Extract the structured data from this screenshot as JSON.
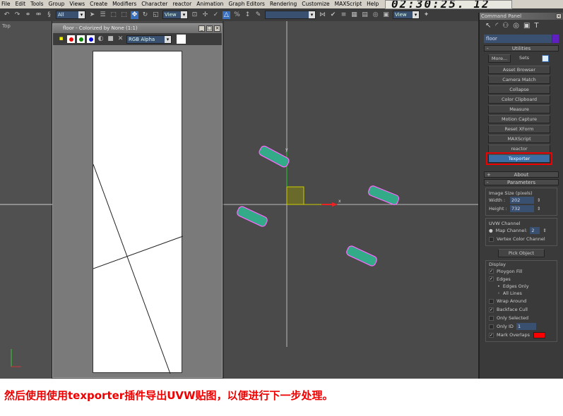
{
  "menu": [
    "File",
    "Edit",
    "Tools",
    "Group",
    "Views",
    "Create",
    "Modifiers",
    "Character",
    "reactor",
    "Animation",
    "Graph Editors",
    "Rendering",
    "Customize",
    "MAXScript",
    "Help"
  ],
  "toolbar": {
    "selection_filter": "All",
    "ref_coord": "View",
    "ref_coord2": "View",
    "named_sel": ""
  },
  "timer": "02:30:25. 12",
  "viewport": {
    "left_label": "Top",
    "axis_x": "x",
    "axis_y": "y"
  },
  "image_window": {
    "title": "floor - Colorized by None (1:1)",
    "channel": "RGB Alpha"
  },
  "command_panel": {
    "title": "Command Panel",
    "object_name": "floor",
    "object_color": "#6020c0",
    "utilities": {
      "header": "Utilities",
      "more": "More...",
      "sets": "Sets",
      "buttons": [
        "Asset Browser",
        "Camera Match",
        "Collapse",
        "Color Clipboard",
        "Measure",
        "Motion Capture",
        "Reset XForm",
        "MAXScript",
        "reactor",
        "Texporter"
      ],
      "active": "Texporter"
    },
    "about": "About",
    "parameters": "Parameters",
    "image_size": {
      "label": "Image Size (pixels)",
      "width_label": "Width :",
      "width": "202",
      "height_label": "Height :",
      "height": "732"
    },
    "uvw": {
      "label": "UVW Channel",
      "map_channel_label": "Map Channel:",
      "map_channel": "2",
      "vertex_color": "Vertex Color Channel"
    },
    "pick_object": "Pick Object",
    "display": {
      "label": "Display",
      "polygon_fill": "Ploygon Fill",
      "edges": "Edges",
      "edges_only": "Edges Only",
      "all_lines": "All Lines",
      "wrap_around": "Wrap Around",
      "backface_cull": "Backface Cull",
      "only_selected": "Only Selected",
      "only_id": "Only ID",
      "only_id_value": "1",
      "mark_overlaps": "Mark Overlaps",
      "overlap_color": "#ff0000"
    }
  },
  "caption": "然后使用使用texporter插件导出UVW贴图，以便进行下一步处理。"
}
